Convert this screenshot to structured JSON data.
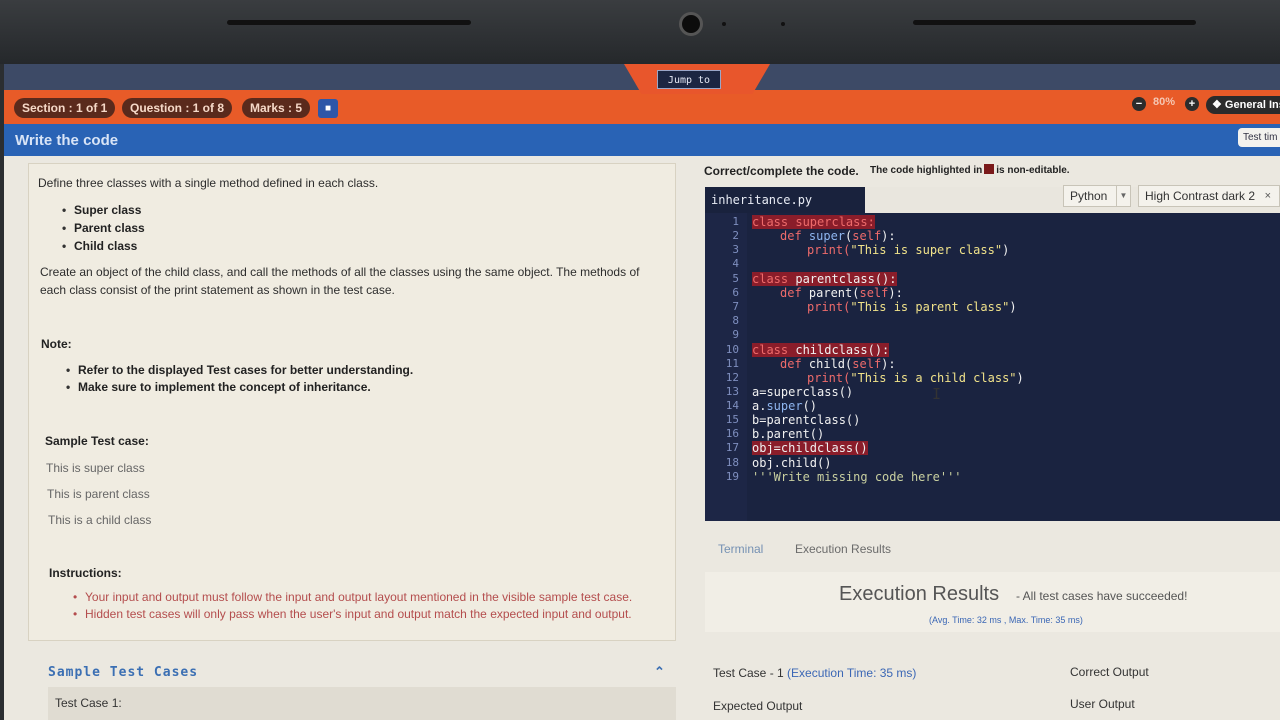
{
  "header": {
    "jump_label": "Jump to",
    "section": "Section : 1 of 1",
    "question": "Question : 1 of 8",
    "marks": "Marks : 5",
    "zoom": "80%",
    "general_instructions": "General Ins",
    "test_time": "Test tim"
  },
  "title_bar": {
    "title": "Write the code"
  },
  "question": {
    "intro": "Define three classes with a single method defined in each class.",
    "classes": [
      "Super class",
      "Parent class",
      "Child class"
    ],
    "para1": "Create an object of the child class, and call the methods of all the classes using the same object. The methods of",
    "para2": "each class consist of the print statement as shown in the test case.",
    "note_label": "Note:",
    "notes": [
      "Refer to the displayed Test cases for better understanding.",
      "Make sure to implement the concept of inheritance."
    ],
    "sample_label": "Sample Test case:",
    "sample_lines": [
      "This is super class",
      "This is parent class",
      "This is a child class"
    ],
    "instructions_label": "Instructions:",
    "instructions": [
      "Your input and output must follow the input and output layout mentioned in the visible sample test case.",
      "Hidden test cases will only pass when the user's input and output match the expected input and output."
    ]
  },
  "editor": {
    "heading": "Correct/complete the code.",
    "sub_before": "The code highlighted in",
    "sub_after": "is non-editable.",
    "filename": "inheritance.py",
    "language": "Python",
    "theme": "High Contrast dark 2",
    "line_numbers": [
      "1",
      "2",
      "3",
      "4",
      "5",
      "6",
      "7",
      "8",
      "9",
      "10",
      "11",
      "12",
      "13",
      "14",
      "15",
      "16",
      "17",
      "18",
      "19"
    ],
    "code": {
      "l1": "class superclass:",
      "l2a": "def ",
      "l2b": "super",
      "l2c": "(",
      "l2d": "self",
      "l2e": "):",
      "l3a": "print(",
      "l3b": "\"This is super class\"",
      "l3c": ")",
      "l5a": "class ",
      "l5b": "parentclass():",
      "l6a": "def ",
      "l6b": "parent(",
      "l6c": "self",
      "l6d": "):",
      "l7a": "print(",
      "l7b": "\"This is parent class\"",
      "l7c": ")",
      "l10a": "class ",
      "l10b": "childclass():",
      "l11a": "def ",
      "l11b": "child(",
      "l11c": "self",
      "l11d": "):",
      "l12a": "print(",
      "l12b": "\"This is a child class\"",
      "l12c": ")",
      "l13": "a=superclass()",
      "l14a": "a.",
      "l14b": "super",
      "l14c": "()",
      "l15": "b=parentclass()",
      "l16": "b.parent()",
      "l17": "obj=childclass()",
      "l18": "obj.child()",
      "l19": "'''Write missing code here'''"
    }
  },
  "results": {
    "tab_terminal": "Terminal",
    "tab_execution": "Execution Results",
    "title": "Execution Results",
    "subtitle": "- All test cases have succeeded!",
    "avg": "(Avg. Time: 32 ms , Max. Time: 35 ms)"
  },
  "bottom": {
    "sample_heading": "Sample Test Cases",
    "test_case_1": "Test Case 1:",
    "tc_label": "Test Case - 1",
    "tc_time": "(Execution Time: 35 ms)",
    "correct_output": "Correct Output",
    "expected_output": "Expected Output",
    "user_output": "User Output"
  },
  "colors": {
    "accent_orange": "#e85b28",
    "title_blue": "#2963b5",
    "editor_bg": "#1a2340",
    "non_editable": "#8a1d2a"
  }
}
